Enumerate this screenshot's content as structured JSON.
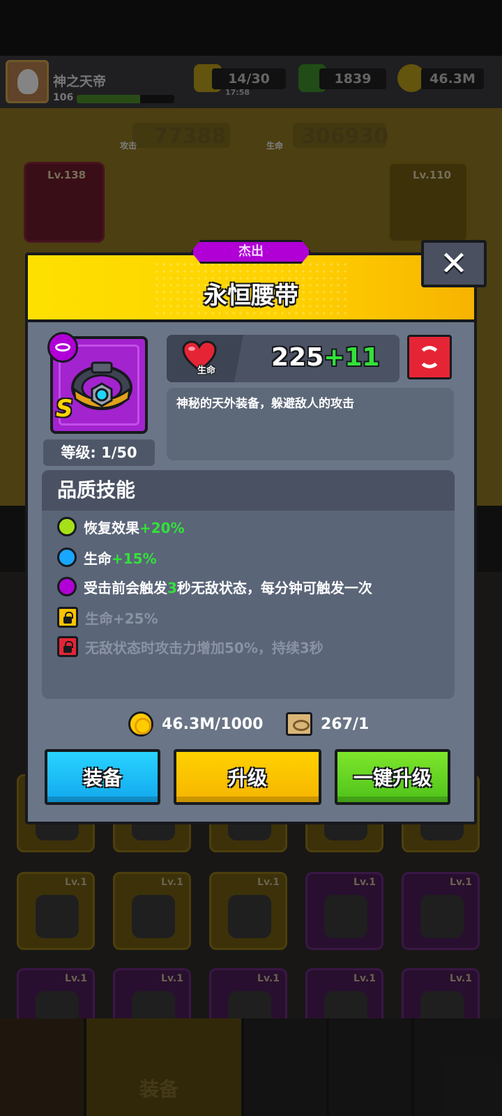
{
  "player": {
    "name": "神之天帝",
    "level": "106",
    "xp_fraction": 0.65
  },
  "resources": {
    "energy": "14/30",
    "energy_timer": "17:58",
    "gems": "1839",
    "gold": "46.3M"
  },
  "background_stats": {
    "attack_value": "77388",
    "attack_label": "攻击",
    "hp_value": "306930",
    "hp_label": "生命"
  },
  "background_slots": {
    "left_level": "Lv.138",
    "right_level": "Lv.110",
    "grid": [
      {
        "level": ""
      },
      {
        "level": ""
      },
      {
        "level": ""
      },
      {
        "level": ""
      },
      {
        "level": ""
      },
      {
        "level": "Lv.1"
      },
      {
        "level": "Lv.1"
      },
      {
        "level": "Lv.1"
      },
      {
        "level": "Lv.1"
      },
      {
        "level": "Lv.1"
      },
      {
        "level": "Lv.1"
      },
      {
        "level": "Lv.1"
      },
      {
        "level": "Lv.1"
      },
      {
        "level": "Lv.1"
      },
      {
        "level": "Lv.1"
      }
    ]
  },
  "bottom_nav": {
    "active_label": "装备"
  },
  "dialog": {
    "rarity": "杰出",
    "title": "永恒腰带",
    "grade": "S",
    "level_text": "等级: 1/50",
    "stat": {
      "label": "生命",
      "base": "225",
      "bonus": "+11"
    },
    "description": "神秘的天外装备，躲避敌人的攻击",
    "quality_title": "品质技能",
    "skills": [
      {
        "color": "#a6e019",
        "prefix": "恢复效果",
        "highlight": "+20%",
        "suffix": "",
        "locked": false
      },
      {
        "color": "#19a6ff",
        "prefix": "生命",
        "highlight": "+15%",
        "suffix": "",
        "locked": false
      },
      {
        "color": "#b000d6",
        "prefix": "受击前会触发",
        "highlight": "3",
        "suffix": "秒无敌状态，每分钟可触发一次",
        "locked": false
      },
      {
        "color": "#ffc400",
        "prefix": "生命+25%",
        "highlight": "",
        "suffix": "",
        "locked": true
      },
      {
        "color": "#e52535",
        "prefix": "无敌状态时攻击力增加50%，持续3秒",
        "highlight": "",
        "suffix": "",
        "locked": true
      }
    ],
    "cost_gold": "46.3M/1000",
    "cost_scroll": "267/1",
    "buttons": {
      "equip": "装备",
      "upgrade": "升级",
      "upgrade_all": "一键升级"
    }
  },
  "colors": {
    "modal_bg": "#6a7587",
    "rarity_purple": "#b000d6",
    "bonus_green": "#33e13a",
    "header_yellow": "#ffd000"
  }
}
